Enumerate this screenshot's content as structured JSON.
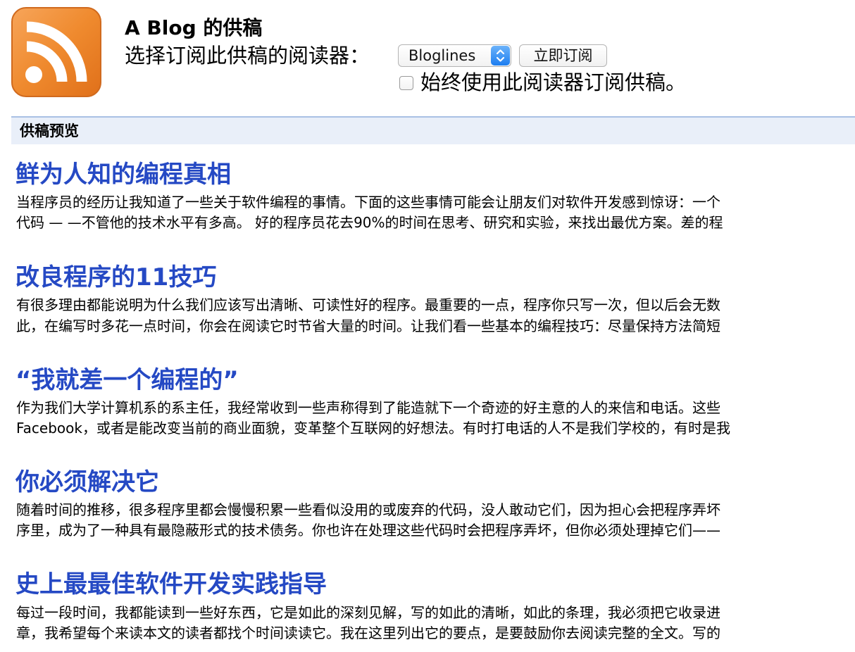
{
  "header": {
    "feed_title": "A Blog 的供稿",
    "reader_label": "选择订阅此供稿的阅读器：",
    "reader_selected": "Bloglines",
    "subscribe_button": "立即订阅",
    "always_use_label": "始终使用此阅读器订阅供稿。",
    "logo_icon": "rss-feed-icon"
  },
  "preview": {
    "heading": "供稿预览"
  },
  "entries": [
    {
      "title": "鲜为人知的编程真相",
      "line1": "当程序员的经历让我知道了一些关于软件编程的事情。下面的这些事情可能会让朋友们对软件开发感到惊讶：一个",
      "line2": "代码 — —不管他的技术水平有多高。 好的程序员花去90%的时间在思考、研究和实验，来找出最优方案。差的程"
    },
    {
      "title": "改良程序的11技巧",
      "line1": "有很多理由都能说明为什么我们应该写出清晰、可读性好的程序。最重要的一点，程序你只写一次，但以后会无数",
      "line2": "此，在编写时多花一点时间，你会在阅读它时节省大量的时间。让我们看一些基本的编程技巧：尽量保持方法简短"
    },
    {
      "title": "“我就差一个编程的”",
      "line1": "作为我们大学计算机系的系主任，我经常收到一些声称得到了能造就下一个奇迹的好主意的人的来信和电话。这些",
      "line2": "Facebook，或者是能改变当前的商业面貌，变革整个互联网的好想法。有时打电话的人不是我们学校的，有时是我"
    },
    {
      "title": "你必须解决它",
      "line1": "随着时间的推移，很多程序里都会慢慢积累一些看似没用的或废弃的代码，没人敢动它们，因为担心会把程序弄坏",
      "line2": "序里，成为了一种具有最隐蔽形式的技术债务。你也许在处理这些代码时会把程序弄坏，但你必须处理掉它们——"
    },
    {
      "title": "史上最最佳软件开发实践指导",
      "line1": "每过一段时间，我都能读到一些好东西，它是如此的深刻见解，写的如此的清晰，如此的条理，我必须把它收录进",
      "line2": "章，我希望每个来读本文的读者都找个时间读读它。我在这里列出它的要点，是要鼓励你去阅读完整的全文。写的"
    }
  ],
  "colors": {
    "entry_title": "#2549c4",
    "preview_bar_bg": "#e9eff9",
    "preview_bar_border": "#a9c0e4",
    "rss_orange": "#f08a2c"
  }
}
